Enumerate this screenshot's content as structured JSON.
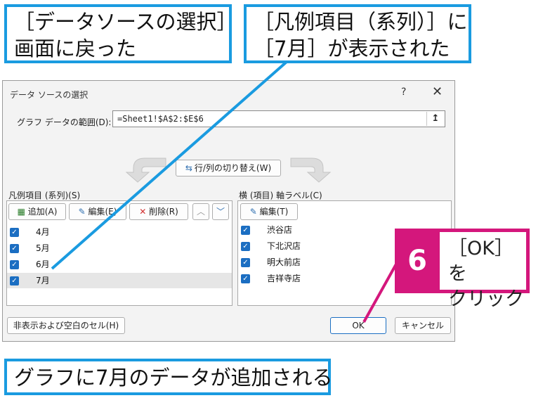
{
  "callouts": {
    "top_left_line1": "［データソースの選択］",
    "top_left_line2": "画面に戻った",
    "top_right_line1": "［凡例項目（系列）］に",
    "top_right_line2": "［7月］が表示された",
    "bottom": "グラフに7月のデータが追加される"
  },
  "dialog": {
    "title": "データ ソースの選択",
    "help": "?",
    "close": "✕",
    "range_label": "グラフ データの範囲(D):",
    "range_value": "=Sheet1!$A$2:$E$6",
    "switch_button": "行/列の切り替え(W)",
    "legend_label": "凡例項目 (系列)(S)",
    "axis_label": "横 (項目) 軸ラベル(C)",
    "add_button": "追加(A)",
    "edit_button": "編集(E)",
    "delete_button": "削除(R)",
    "axis_edit_button": "編集(T)",
    "series": [
      "4月",
      "5月",
      "6月",
      "7月"
    ],
    "categories": [
      "渋谷店",
      "下北沢店",
      "明大前店",
      "吉祥寺店"
    ],
    "hidden_cells_button": "非表示および空白のセル(H)",
    "ok_button": "OK",
    "cancel_button": "キャンセル"
  },
  "step": {
    "number": "6",
    "line1": "［OK］を",
    "line2": "クリック"
  },
  "colors": {
    "callout_border": "#1a9be0",
    "step_accent": "#d4177c",
    "checkbox": "#1b6ec2"
  }
}
